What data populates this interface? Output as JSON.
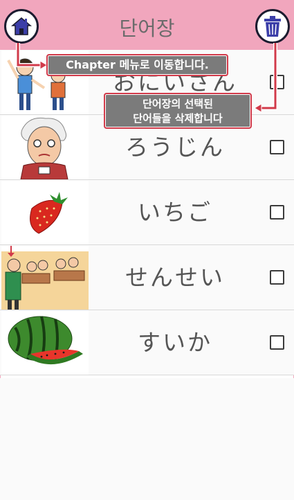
{
  "header": {
    "title": "단어장",
    "home_icon": "home-icon",
    "trash_icon": "trash-icon"
  },
  "tooltips": {
    "home": "Chapter 메뉴로 이동합니다.",
    "delete_line1": "단어장의 선택된",
    "delete_line2": "단어들을 삭제합니다"
  },
  "words": [
    {
      "word": "おにいさん",
      "image": "children-illustration",
      "checked": false
    },
    {
      "word": "ろうじん",
      "image": "old-man-illustration",
      "checked": false
    },
    {
      "word": "いちご",
      "image": "strawberry-illustration",
      "checked": false
    },
    {
      "word": "せんせい",
      "image": "teacher-classroom-illustration",
      "checked": false
    },
    {
      "word": "すいか",
      "image": "watermelon-illustration",
      "checked": false
    }
  ],
  "colors": {
    "header": "#f1a6bd",
    "tooltip_bg": "#7b7b7b",
    "tooltip_border": "#d13a4a",
    "arrow": "#d13a4a",
    "icon": "#3b3ea8"
  }
}
